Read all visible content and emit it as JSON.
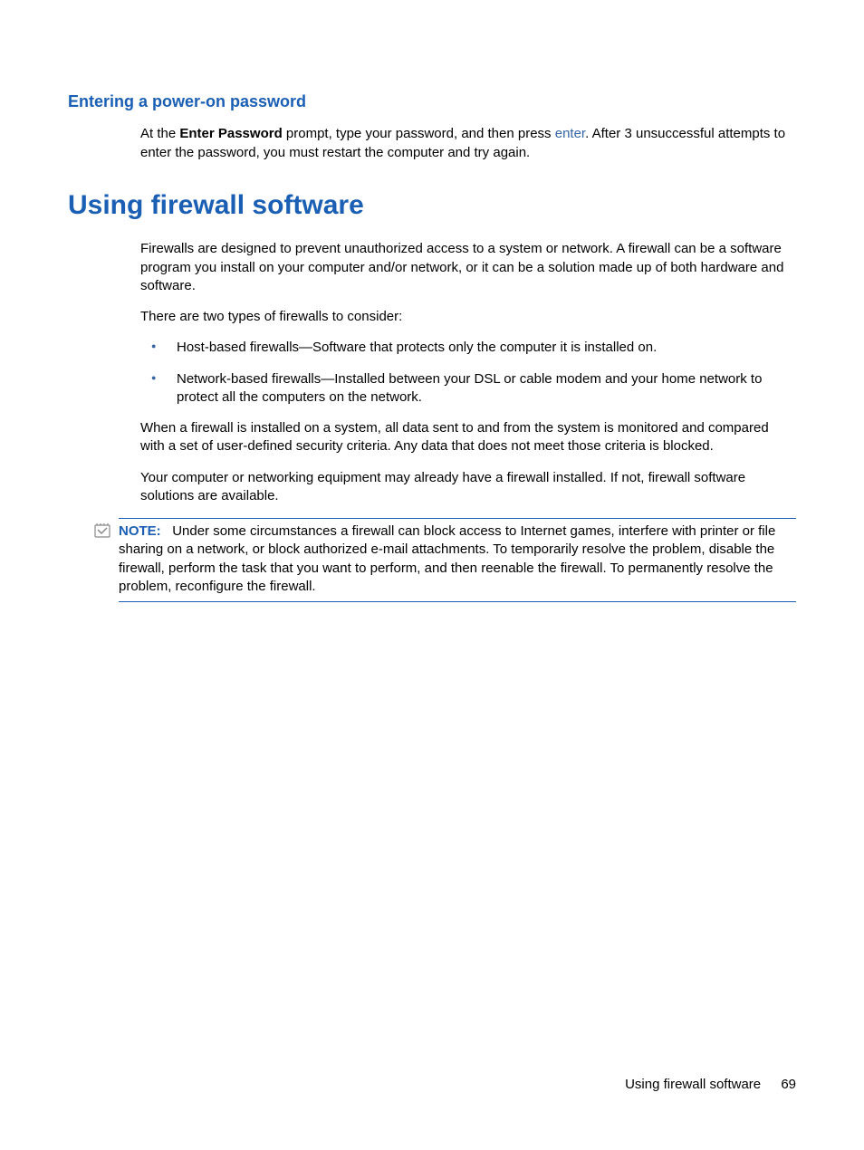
{
  "section1": {
    "heading": "Entering a power-on password",
    "para_pre": "At the ",
    "para_bold": "Enter Password",
    "para_mid": " prompt, type your password, and then press ",
    "para_key": "enter",
    "para_post": ". After 3 unsuccessful attempts to enter the password, you must restart the computer and try again."
  },
  "section2": {
    "heading": "Using firewall software",
    "para1": "Firewalls are designed to prevent unauthorized access to a system or network. A firewall can be a software program you install on your computer and/or network, or it can be a solution made up of both hardware and software.",
    "para2": "There are two types of firewalls to consider:",
    "bullets": [
      "Host-based firewalls—Software that protects only the computer it is installed on.",
      "Network-based firewalls—Installed between your DSL or cable modem and your home network to protect all the computers on the network."
    ],
    "para3": "When a firewall is installed on a system, all data sent to and from the system is monitored and compared with a set of user-defined security criteria. Any data that does not meet those criteria is blocked.",
    "para4": "Your computer or networking equipment may already have a firewall installed. If not, firewall software solutions are available.",
    "note_label": "NOTE:",
    "note_text": "Under some circumstances a firewall can block access to Internet games, interfere with printer or file sharing on a network, or block authorized e-mail attachments. To temporarily resolve the problem, disable the firewall, perform the task that you want to perform, and then reenable the firewall. To permanently resolve the problem, reconfigure the firewall."
  },
  "footer": {
    "text": "Using firewall software",
    "page": "69"
  }
}
